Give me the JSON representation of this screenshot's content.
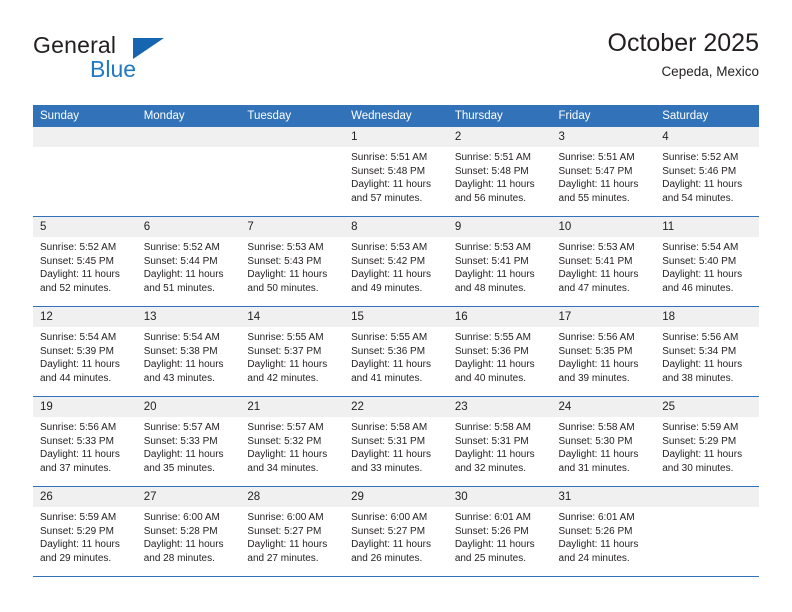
{
  "brand": {
    "name_top": "General",
    "name_bottom": "Blue",
    "triangle_color": "#1565b0",
    "blue_color": "#1f7ac4"
  },
  "header": {
    "month_title": "October 2025",
    "location": "Cepeda, Mexico"
  },
  "theme": {
    "header_bg": "#3172b9",
    "header_text": "#ffffff",
    "daynum_bg": "#f0f0f0",
    "grid_line": "#3172b9",
    "text": "#231f20"
  },
  "weekday_headers": [
    "Sunday",
    "Monday",
    "Tuesday",
    "Wednesday",
    "Thursday",
    "Friday",
    "Saturday"
  ],
  "labels": {
    "sunrise_prefix": "Sunrise:",
    "sunset_prefix": "Sunset:",
    "daylight_prefix": "Daylight:"
  },
  "weeks": [
    [
      {
        "day": "",
        "blank": true
      },
      {
        "day": "",
        "blank": true
      },
      {
        "day": "",
        "blank": true
      },
      {
        "day": "1",
        "sunrise": "Sunrise: 5:51 AM",
        "sunset": "Sunset: 5:48 PM",
        "daylight_1": "Daylight: 11 hours",
        "daylight_2": "and 57 minutes."
      },
      {
        "day": "2",
        "sunrise": "Sunrise: 5:51 AM",
        "sunset": "Sunset: 5:48 PM",
        "daylight_1": "Daylight: 11 hours",
        "daylight_2": "and 56 minutes."
      },
      {
        "day": "3",
        "sunrise": "Sunrise: 5:51 AM",
        "sunset": "Sunset: 5:47 PM",
        "daylight_1": "Daylight: 11 hours",
        "daylight_2": "and 55 minutes."
      },
      {
        "day": "4",
        "sunrise": "Sunrise: 5:52 AM",
        "sunset": "Sunset: 5:46 PM",
        "daylight_1": "Daylight: 11 hours",
        "daylight_2": "and 54 minutes."
      }
    ],
    [
      {
        "day": "5",
        "sunrise": "Sunrise: 5:52 AM",
        "sunset": "Sunset: 5:45 PM",
        "daylight_1": "Daylight: 11 hours",
        "daylight_2": "and 52 minutes."
      },
      {
        "day": "6",
        "sunrise": "Sunrise: 5:52 AM",
        "sunset": "Sunset: 5:44 PM",
        "daylight_1": "Daylight: 11 hours",
        "daylight_2": "and 51 minutes."
      },
      {
        "day": "7",
        "sunrise": "Sunrise: 5:53 AM",
        "sunset": "Sunset: 5:43 PM",
        "daylight_1": "Daylight: 11 hours",
        "daylight_2": "and 50 minutes."
      },
      {
        "day": "8",
        "sunrise": "Sunrise: 5:53 AM",
        "sunset": "Sunset: 5:42 PM",
        "daylight_1": "Daylight: 11 hours",
        "daylight_2": "and 49 minutes."
      },
      {
        "day": "9",
        "sunrise": "Sunrise: 5:53 AM",
        "sunset": "Sunset: 5:41 PM",
        "daylight_1": "Daylight: 11 hours",
        "daylight_2": "and 48 minutes."
      },
      {
        "day": "10",
        "sunrise": "Sunrise: 5:53 AM",
        "sunset": "Sunset: 5:41 PM",
        "daylight_1": "Daylight: 11 hours",
        "daylight_2": "and 47 minutes."
      },
      {
        "day": "11",
        "sunrise": "Sunrise: 5:54 AM",
        "sunset": "Sunset: 5:40 PM",
        "daylight_1": "Daylight: 11 hours",
        "daylight_2": "and 46 minutes."
      }
    ],
    [
      {
        "day": "12",
        "sunrise": "Sunrise: 5:54 AM",
        "sunset": "Sunset: 5:39 PM",
        "daylight_1": "Daylight: 11 hours",
        "daylight_2": "and 44 minutes."
      },
      {
        "day": "13",
        "sunrise": "Sunrise: 5:54 AM",
        "sunset": "Sunset: 5:38 PM",
        "daylight_1": "Daylight: 11 hours",
        "daylight_2": "and 43 minutes."
      },
      {
        "day": "14",
        "sunrise": "Sunrise: 5:55 AM",
        "sunset": "Sunset: 5:37 PM",
        "daylight_1": "Daylight: 11 hours",
        "daylight_2": "and 42 minutes."
      },
      {
        "day": "15",
        "sunrise": "Sunrise: 5:55 AM",
        "sunset": "Sunset: 5:36 PM",
        "daylight_1": "Daylight: 11 hours",
        "daylight_2": "and 41 minutes."
      },
      {
        "day": "16",
        "sunrise": "Sunrise: 5:55 AM",
        "sunset": "Sunset: 5:36 PM",
        "daylight_1": "Daylight: 11 hours",
        "daylight_2": "and 40 minutes."
      },
      {
        "day": "17",
        "sunrise": "Sunrise: 5:56 AM",
        "sunset": "Sunset: 5:35 PM",
        "daylight_1": "Daylight: 11 hours",
        "daylight_2": "and 39 minutes."
      },
      {
        "day": "18",
        "sunrise": "Sunrise: 5:56 AM",
        "sunset": "Sunset: 5:34 PM",
        "daylight_1": "Daylight: 11 hours",
        "daylight_2": "and 38 minutes."
      }
    ],
    [
      {
        "day": "19",
        "sunrise": "Sunrise: 5:56 AM",
        "sunset": "Sunset: 5:33 PM",
        "daylight_1": "Daylight: 11 hours",
        "daylight_2": "and 37 minutes."
      },
      {
        "day": "20",
        "sunrise": "Sunrise: 5:57 AM",
        "sunset": "Sunset: 5:33 PM",
        "daylight_1": "Daylight: 11 hours",
        "daylight_2": "and 35 minutes."
      },
      {
        "day": "21",
        "sunrise": "Sunrise: 5:57 AM",
        "sunset": "Sunset: 5:32 PM",
        "daylight_1": "Daylight: 11 hours",
        "daylight_2": "and 34 minutes."
      },
      {
        "day": "22",
        "sunrise": "Sunrise: 5:58 AM",
        "sunset": "Sunset: 5:31 PM",
        "daylight_1": "Daylight: 11 hours",
        "daylight_2": "and 33 minutes."
      },
      {
        "day": "23",
        "sunrise": "Sunrise: 5:58 AM",
        "sunset": "Sunset: 5:31 PM",
        "daylight_1": "Daylight: 11 hours",
        "daylight_2": "and 32 minutes."
      },
      {
        "day": "24",
        "sunrise": "Sunrise: 5:58 AM",
        "sunset": "Sunset: 5:30 PM",
        "daylight_1": "Daylight: 11 hours",
        "daylight_2": "and 31 minutes."
      },
      {
        "day": "25",
        "sunrise": "Sunrise: 5:59 AM",
        "sunset": "Sunset: 5:29 PM",
        "daylight_1": "Daylight: 11 hours",
        "daylight_2": "and 30 minutes."
      }
    ],
    [
      {
        "day": "26",
        "sunrise": "Sunrise: 5:59 AM",
        "sunset": "Sunset: 5:29 PM",
        "daylight_1": "Daylight: 11 hours",
        "daylight_2": "and 29 minutes."
      },
      {
        "day": "27",
        "sunrise": "Sunrise: 6:00 AM",
        "sunset": "Sunset: 5:28 PM",
        "daylight_1": "Daylight: 11 hours",
        "daylight_2": "and 28 minutes."
      },
      {
        "day": "28",
        "sunrise": "Sunrise: 6:00 AM",
        "sunset": "Sunset: 5:27 PM",
        "daylight_1": "Daylight: 11 hours",
        "daylight_2": "and 27 minutes."
      },
      {
        "day": "29",
        "sunrise": "Sunrise: 6:00 AM",
        "sunset": "Sunset: 5:27 PM",
        "daylight_1": "Daylight: 11 hours",
        "daylight_2": "and 26 minutes."
      },
      {
        "day": "30",
        "sunrise": "Sunrise: 6:01 AM",
        "sunset": "Sunset: 5:26 PM",
        "daylight_1": "Daylight: 11 hours",
        "daylight_2": "and 25 minutes."
      },
      {
        "day": "31",
        "sunrise": "Sunrise: 6:01 AM",
        "sunset": "Sunset: 5:26 PM",
        "daylight_1": "Daylight: 11 hours",
        "daylight_2": "and 24 minutes."
      },
      {
        "day": "",
        "blank": true
      }
    ]
  ]
}
